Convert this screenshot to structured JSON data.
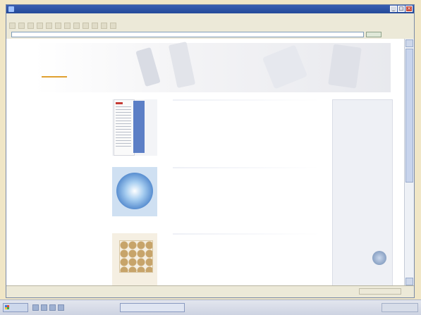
{
  "window": {
    "title": "",
    "buttons": [
      "_",
      "□",
      "×"
    ]
  },
  "menubar": {
    "items": [
      "",
      "",
      "",
      "",
      "",
      ""
    ]
  },
  "toolbar": {
    "items": [
      "",
      "",
      "",
      "",
      "",
      "",
      "",
      "",
      "",
      "",
      "",
      ""
    ]
  },
  "address": {
    "label": "",
    "url": "",
    "go_label": ""
  },
  "site": {
    "logo": "",
    "top_links": [
      "",
      "",
      ""
    ],
    "nav_tabs": [
      "",
      "",
      "",
      "",
      "",
      ""
    ]
  },
  "articles": [
    {
      "headline": "",
      "items": [
        "",
        "",
        "",
        "",
        "",
        ""
      ]
    },
    {
      "headline": "",
      "thumb_caption": "",
      "items": [
        "",
        "",
        "",
        "",
        "",
        "",
        ""
      ]
    },
    {
      "headline": "",
      "items": [
        "",
        "",
        "",
        "",
        "",
        "",
        "",
        "",
        ""
      ]
    }
  ],
  "sidebar": {
    "title": "",
    "news": [
      {
        "headline": "",
        "date": "",
        "preview": ""
      },
      {
        "headline": "",
        "date": "",
        "preview": ""
      },
      {
        "headline": "",
        "date": "",
        "preview": ""
      }
    ],
    "more_link": ""
  },
  "status": {
    "text": ""
  },
  "taskbar": {
    "start": "",
    "task": "",
    "clock": ""
  }
}
